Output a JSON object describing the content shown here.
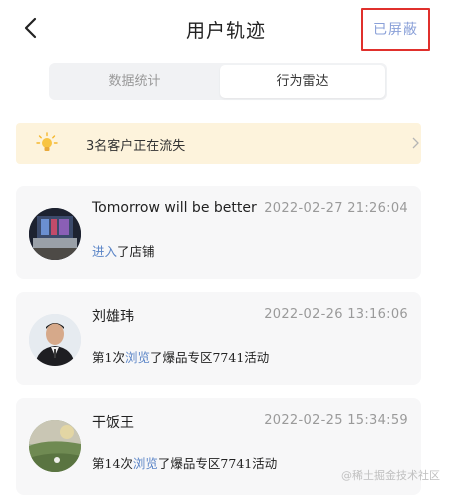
{
  "nav": {
    "title": "用户轨迹",
    "block_label": "已屏蔽"
  },
  "segments": [
    "数据统计",
    "行为雷达"
  ],
  "alert": {
    "text": "3名客户正在流失"
  },
  "records": [
    {
      "name": "Tomorrow will be better",
      "time": "2022-02-27 21:26:04",
      "desc_prefix": "",
      "action": "进入",
      "desc_suffix": "了店铺"
    },
    {
      "name": "刘雄玮",
      "time": "2022-02-26 13:16:06",
      "desc_prefix": "第1次",
      "action": "浏览",
      "desc_suffix": "了爆品专区7741活动"
    },
    {
      "name": "干饭王",
      "time": "2022-02-25 15:34:59",
      "desc_prefix": "第14次",
      "action": "浏览",
      "desc_suffix": "了爆品专区7741活动"
    }
  ],
  "watermark": "@稀土掘金技术社区",
  "colors": {
    "link": "#5b85c7",
    "highlight_border": "#e0302c",
    "alert_bg": "#fdf3dc"
  }
}
